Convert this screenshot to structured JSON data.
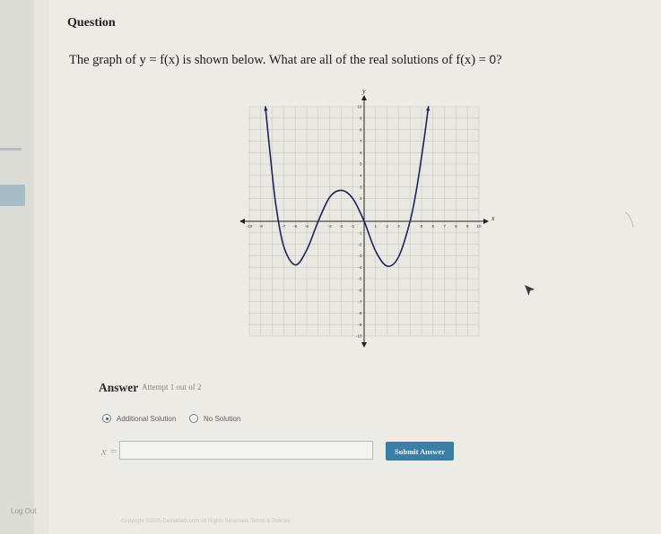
{
  "question": {
    "heading": "Question",
    "text_start": "The graph of y = f(x) is shown below. What are all of the real solutions of f(x) = ",
    "text_zero": "0",
    "text_end": "?"
  },
  "graph": {
    "x_axis_label": "x",
    "y_axis_label": "y",
    "x_ticks": [
      {
        "label": "-10",
        "value": -10
      },
      {
        "label": "-9",
        "value": -9
      },
      {
        "label": "-7",
        "value": -7
      },
      {
        "label": "-6",
        "value": -6
      },
      {
        "label": "-5",
        "value": -5
      },
      {
        "label": "-3",
        "value": -3
      },
      {
        "label": "-2",
        "value": -2
      },
      {
        "label": "-1",
        "value": -1
      },
      {
        "label": "1",
        "value": 1
      },
      {
        "label": "2",
        "value": 2
      },
      {
        "label": "3",
        "value": 3
      },
      {
        "label": "5",
        "value": 5
      },
      {
        "label": "6",
        "value": 6
      },
      {
        "label": "7",
        "value": 7
      },
      {
        "label": "8",
        "value": 8
      },
      {
        "label": "9",
        "value": 9
      },
      {
        "label": "10",
        "value": 10
      }
    ],
    "y_ticks": [
      {
        "label": "10",
        "value": 10
      },
      {
        "label": "9",
        "value": 9
      },
      {
        "label": "8",
        "value": 8
      },
      {
        "label": "7",
        "value": 7
      },
      {
        "label": "6",
        "value": 6
      },
      {
        "label": "5",
        "value": 5
      },
      {
        "label": "4",
        "value": 4
      },
      {
        "label": "3",
        "value": 3
      },
      {
        "label": "2",
        "value": 2
      },
      {
        "label": "-1",
        "value": -1
      },
      {
        "label": "-2",
        "value": -2
      },
      {
        "label": "-3",
        "value": -3
      },
      {
        "label": "-4",
        "value": -4
      },
      {
        "label": "-5",
        "value": -5
      },
      {
        "label": "-6",
        "value": -6
      },
      {
        "label": "-7",
        "value": -7
      },
      {
        "label": "-8",
        "value": -8
      },
      {
        "label": "-9",
        "value": -9
      },
      {
        "label": "-10",
        "value": -10
      }
    ],
    "xlim": [
      -10,
      10
    ],
    "ylim": [
      -10,
      10
    ],
    "grid": true,
    "curve_color": "#22225a",
    "curve_points": [
      [
        -8.6,
        10
      ],
      [
        -8.2,
        6
      ],
      [
        -7.7,
        1.5
      ],
      [
        -7.0,
        -2.2
      ],
      [
        -6.0,
        -3.8
      ],
      [
        -5.0,
        -2.5
      ],
      [
        -4.0,
        0
      ],
      [
        -3.0,
        2.1
      ],
      [
        -2.0,
        2.7
      ],
      [
        -1.0,
        2.0
      ],
      [
        0.0,
        0
      ],
      [
        1.0,
        -2.6
      ],
      [
        2.0,
        -3.9
      ],
      [
        3.0,
        -3.1
      ],
      [
        4.0,
        0
      ],
      [
        4.6,
        3.0
      ],
      [
        5.2,
        7.0
      ],
      [
        5.6,
        10
      ]
    ]
  },
  "answer": {
    "label": "Answer",
    "attempt": "Attempt 1 out of 2",
    "options": [
      {
        "label": "Additional Solution",
        "selected": true
      },
      {
        "label": "No Solution",
        "selected": false
      }
    ],
    "input_label": "x =",
    "input_value": "",
    "submit_label": "Submit Answer"
  },
  "footer": {
    "logout": "Log Out",
    "copyright": "Copyright ©2025 DeltaMath.com All Rights Reserved. Terms & Policies"
  },
  "colors": {
    "accent": "#3c7fa6",
    "curve": "#22225a"
  }
}
